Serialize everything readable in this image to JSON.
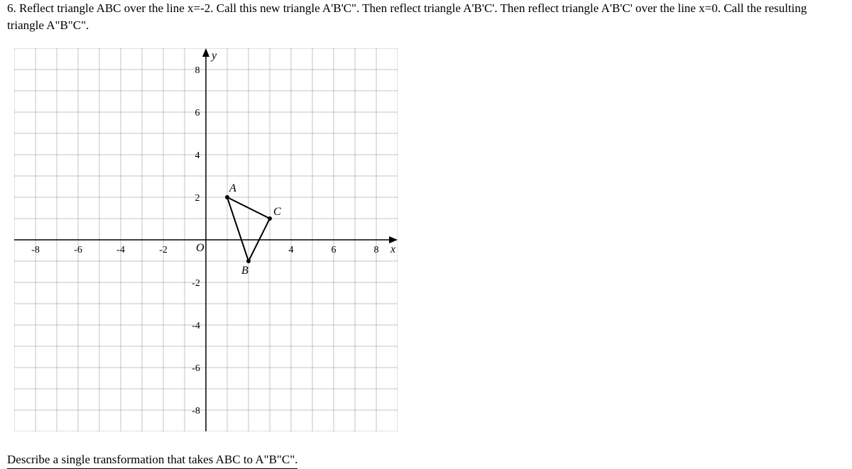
{
  "question": {
    "number": "6.",
    "text": "Reflect triangle ABC over the line x=-2. Call this new triangle A'B'C\". Then reflect triangle A'B'C'. Then reflect triangle A'B'C' over the line x=0. Call the resulting triangle A\"B\"C\"."
  },
  "final_prompt": "Describe a single transformation that takes ABC to A\"B\"C\".",
  "chart_data": {
    "type": "scatter",
    "title": "",
    "xlabel": "x",
    "ylabel": "y",
    "xlim": [
      -8,
      8
    ],
    "ylim": [
      -8,
      8
    ],
    "x_ticks": [
      -8,
      -6,
      -4,
      -2,
      2,
      4,
      6,
      8
    ],
    "y_ticks": [
      -8,
      -6,
      -4,
      -2,
      2,
      4,
      6,
      8
    ],
    "origin_label": "O",
    "triangles": [
      {
        "name": "ABC",
        "points": [
          {
            "label": "A",
            "x": 1,
            "y": 2
          },
          {
            "label": "B",
            "x": 2,
            "y": -1
          },
          {
            "label": "C",
            "x": 3,
            "y": 1
          }
        ]
      }
    ]
  }
}
